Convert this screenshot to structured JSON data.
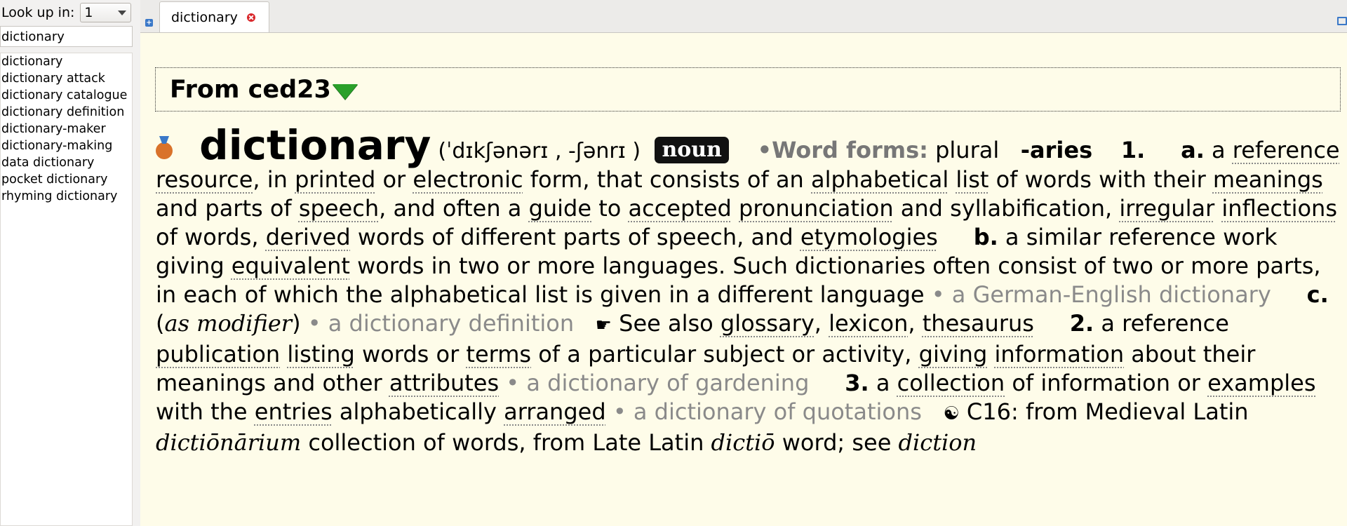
{
  "sidebar": {
    "lookup_label": "Look up in:",
    "lookup_value": "1",
    "search_value": "dictionary",
    "items": [
      {
        "label": "dictionary"
      },
      {
        "label": "dictionary attack"
      },
      {
        "label": "dictionary catalogue"
      },
      {
        "label": "dictionary definition"
      },
      {
        "label": "dictionary-maker"
      },
      {
        "label": "dictionary-making"
      },
      {
        "label": "data dictionary"
      },
      {
        "label": "pocket dictionary"
      },
      {
        "label": "rhyming dictionary"
      }
    ]
  },
  "tabs": [
    {
      "label": "dictionary"
    }
  ],
  "article": {
    "dict_title": "From ced23",
    "headword": "dictionary",
    "pronunciation": "(ˈdɪkʃənərɪ , -ʃənrɪ )",
    "pos": "noun",
    "wordforms_label": "•Word forms:",
    "plural_label": "plural",
    "plural_form": "-aries",
    "s1": "1.",
    "s1a": "a.",
    "t1": "a",
    "w_reference": "reference",
    "w_resource": "resource",
    "t2": ", in",
    "w_printed": "printed",
    "t3": "or",
    "w_electronic": "electronic",
    "t4": "form, that consists of an",
    "w_alphabetical": "alphabetical",
    "w_list": "list",
    "t5": "of words with their",
    "w_meanings": "meanings",
    "t6": "and parts of",
    "w_speech": "speech",
    "t7": ", and often a",
    "w_guide": "guide",
    "t8": "to",
    "w_accepted": "accepted",
    "w_pronunciation": "pronunciation",
    "t9": "and syllabification,",
    "w_irregular": "irregular",
    "w_inflections": "inflections",
    "t10": "of words,",
    "w_derived": "derived",
    "t11": "words of different parts of speech, and",
    "w_etymologies": "etymologies",
    "s1b": "b.",
    "t12": "a similar reference work giving",
    "w_equivalent": "equivalent",
    "t13": "words in two or more languages. Such dictionaries often consist of two or more parts, in each of which the alphabetical list is given in a different language",
    "ex1": "• a German-English dictionary",
    "s1c": "c.",
    "as_modifier": "as modifier",
    "ex2": "• a dictionary definition",
    "see_also": "See also",
    "w_glossary": "glossary",
    "w_lexicon": "lexicon",
    "w_thesaurus": "thesaurus",
    "s2": "2.",
    "t14": "a reference",
    "w_publication": "publication",
    "w_listing": "listing",
    "t15": "words or",
    "w_terms": "terms",
    "t16": "of a particular subject or activity,",
    "w_giving": "giving",
    "w_information": "information",
    "t17": "about their meanings and other",
    "w_attributes": "attributes",
    "ex3": "• a dictionary of gardening",
    "s3": "3.",
    "t18": "a",
    "w_collection": "collection",
    "t19": "of information or",
    "w_examples": "examples",
    "t20": "with the",
    "w_entries": "entries",
    "t21": "alphabetically",
    "w_arranged": "arranged",
    "ex4": "• a dictionary of quotations",
    "t22": "C16: from Medieval Latin",
    "it_dictionarium": "dictiōnārium",
    "t23": "collection of words, from Late Latin",
    "it_dictio": "dictiō",
    "t24": "word; see",
    "it_diction": "diction"
  },
  "icons": {
    "new_tab": "new-tab-icon",
    "tab_close": "close-icon",
    "collapse": "triangle-down-icon",
    "medal": "medal-icon",
    "see_also": "pointing-hand-icon",
    "etymology": "yin-yang-icon"
  },
  "colors": {
    "article_bg": "#fefce9",
    "example_text": "#8a8a8a",
    "collapse_green": "#2aa02a",
    "close_red": "#d9262a"
  }
}
